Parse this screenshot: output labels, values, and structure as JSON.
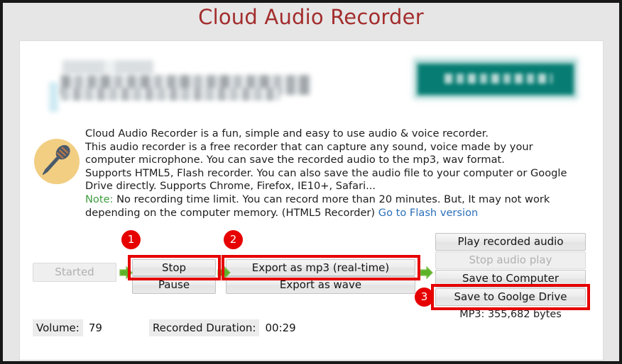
{
  "app": {
    "title": "Cloud Audio Recorder"
  },
  "banner": {
    "redacted": true,
    "accent_color": "#067c72",
    "note": "blurred header banner with teal call-to-action button"
  },
  "description": {
    "line1": "Cloud Audio Recorder is a fun, simple and easy to use audio & voice recorder.",
    "line2": "This audio recorder is a free recorder that can capture any sound, voice made by your",
    "line3": "computer microphone. You can save the recorded audio to the mp3, wav format.",
    "line4": "Supports HTML5, Flash recorder. You can also save the audio file to your computer or Google",
    "line5": "Drive directly. Supports Chrome, Firefox, IE10+, Safari...",
    "note_label": "Note:",
    "note_text": " No recording time limit. You can record more than 20 minutes. But, It may not work",
    "line7": "depending on the computer memory. (HTML5 Recorder)",
    "flash_link": "Go to Flash version",
    "note_color": "#3f9d3f",
    "link_color": "#2a6fb8"
  },
  "icons": {
    "microphone": "microphone-icon",
    "arrow": "green-arrow-right-icon"
  },
  "controls": {
    "started": "Started",
    "started_disabled": true,
    "stop": "Stop",
    "pause": "Pause",
    "export_mp3": "Export as mp3 (real-time)",
    "export_wave": "Export as wave",
    "play_recorded": "Play recorded audio",
    "stop_audio_play": "Stop audio play",
    "stop_audio_play_disabled": true,
    "save_computer": "Save to Computer",
    "save_drive": "Save to Goolge Drive"
  },
  "output": {
    "mp3_size": "MP3: 355,682 bytes"
  },
  "status": {
    "volume_label": "Volume:",
    "volume_value": "79",
    "duration_label": "Recorded Duration:",
    "duration_value": "00:29"
  },
  "annotations": {
    "badge_1": "1",
    "badge_2": "2",
    "badge_3": "3",
    "highlight_color": "#e60000"
  }
}
